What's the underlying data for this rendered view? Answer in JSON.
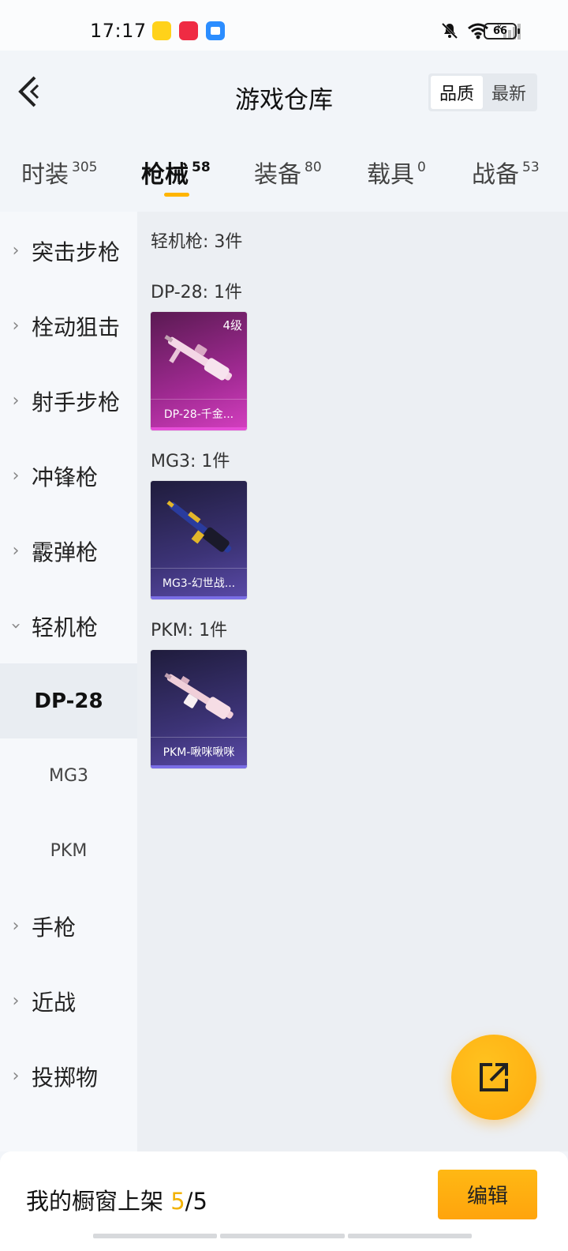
{
  "status_bar": {
    "time": "17:17",
    "battery": "66",
    "icons": [
      "mute-bell-icon",
      "wifi-icon",
      "signal-icon"
    ]
  },
  "header": {
    "title": "游戏仓库",
    "sort_options": [
      "品质",
      "最新"
    ],
    "active_sort": "品质"
  },
  "tabs": [
    {
      "label": "时装",
      "count": "305"
    },
    {
      "label": "枪械",
      "count": "58"
    },
    {
      "label": "装备",
      "count": "80"
    },
    {
      "label": "载具",
      "count": "0"
    },
    {
      "label": "战备",
      "count": "53"
    }
  ],
  "active_tab": "枪械",
  "sidebar": {
    "categories": [
      {
        "label": "突击步枪",
        "expanded": false
      },
      {
        "label": "栓动狙击",
        "expanded": false
      },
      {
        "label": "射手步枪",
        "expanded": false
      },
      {
        "label": "冲锋枪",
        "expanded": false
      },
      {
        "label": "霰弹枪",
        "expanded": false
      },
      {
        "label": "轻机枪",
        "expanded": true
      },
      {
        "label": "手枪",
        "expanded": false
      },
      {
        "label": "近战",
        "expanded": false
      },
      {
        "label": "投掷物",
        "expanded": false
      }
    ],
    "sub_items": [
      "DP-28",
      "MG3",
      "PKM"
    ],
    "active_sub": "DP-28"
  },
  "content": {
    "category_summary": "轻机枪: 3件",
    "groups": [
      {
        "label": "DP-28: 1件",
        "item_name": "DP-28-千金...",
        "level": "4级",
        "rarity_color": "#d43fc0"
      },
      {
        "label": "MG3: 1件",
        "item_name": "MG3-幻世战...",
        "level": "",
        "rarity_color": "#5a4aa8"
      },
      {
        "label": "PKM: 1件",
        "item_name": "PKM-啾咪啾咪",
        "level": "",
        "rarity_color": "#5a4aa8"
      }
    ]
  },
  "bottom_bar": {
    "showcase_label": "我的橱窗上架 ",
    "showcase_current": "5",
    "showcase_total": "/5",
    "edit_label": "编辑"
  },
  "colors": {
    "accent": "#ffb500",
    "edit_button": "#ffa40c"
  }
}
